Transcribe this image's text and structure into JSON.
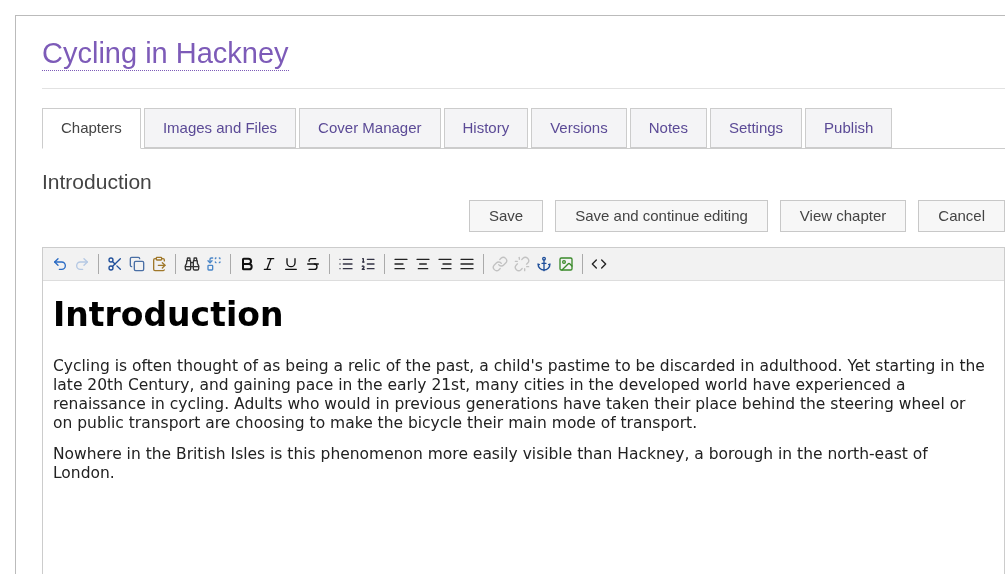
{
  "book_title": "Cycling in Hackney",
  "tabs": [
    {
      "label": "Chapters",
      "selected": true
    },
    {
      "label": "Images and Files",
      "selected": false
    },
    {
      "label": "Cover Manager",
      "selected": false
    },
    {
      "label": "History",
      "selected": false
    },
    {
      "label": "Versions",
      "selected": false
    },
    {
      "label": "Notes",
      "selected": false
    },
    {
      "label": "Settings",
      "selected": false
    },
    {
      "label": "Publish",
      "selected": false
    }
  ],
  "chapter_title": "Introduction",
  "buttons": [
    "Save",
    "Save and continue editing",
    "View chapter",
    "Cancel"
  ],
  "toolbar": [
    [
      {
        "kind": "undo",
        "disabled": false
      },
      {
        "kind": "redo",
        "disabled": true
      }
    ],
    [
      {
        "kind": "cut",
        "disabled": false
      },
      {
        "kind": "copy",
        "disabled": false
      },
      {
        "kind": "paste",
        "disabled": false
      }
    ],
    [
      {
        "kind": "find",
        "disabled": false
      },
      {
        "kind": "replace",
        "disabled": false
      }
    ],
    [
      {
        "kind": "bold",
        "disabled": false
      },
      {
        "kind": "italic",
        "disabled": false
      },
      {
        "kind": "underline",
        "disabled": false
      },
      {
        "kind": "strike",
        "disabled": false
      }
    ],
    [
      {
        "kind": "bullets",
        "disabled": false
      },
      {
        "kind": "numbers",
        "disabled": false
      }
    ],
    [
      {
        "kind": "left",
        "disabled": false
      },
      {
        "kind": "center",
        "disabled": false
      },
      {
        "kind": "right",
        "disabled": false
      },
      {
        "kind": "justify",
        "disabled": false
      }
    ],
    [
      {
        "kind": "link",
        "disabled": true
      },
      {
        "kind": "unlink",
        "disabled": true
      },
      {
        "kind": "anchor",
        "disabled": false
      },
      {
        "kind": "image",
        "disabled": false
      }
    ],
    [
      {
        "kind": "html",
        "disabled": false
      }
    ]
  ],
  "content": {
    "heading": "Introduction",
    "paragraphs": [
      "Cycling is often thought of as being a relic of the past, a child's pastime to be discarded in adulthood. Yet starting in the late 20th Century, and gaining pace in the early 21st, many cities in the developed world have experienced a renaissance in cycling. Adults who would in previous generations have taken their place behind the steering wheel or on public transport are choosing to make the bicycle their main mode of transport.",
      "Nowhere in the British Isles is this phenomenon more easily visible than Hackney, a borough in the north-east of London."
    ]
  }
}
